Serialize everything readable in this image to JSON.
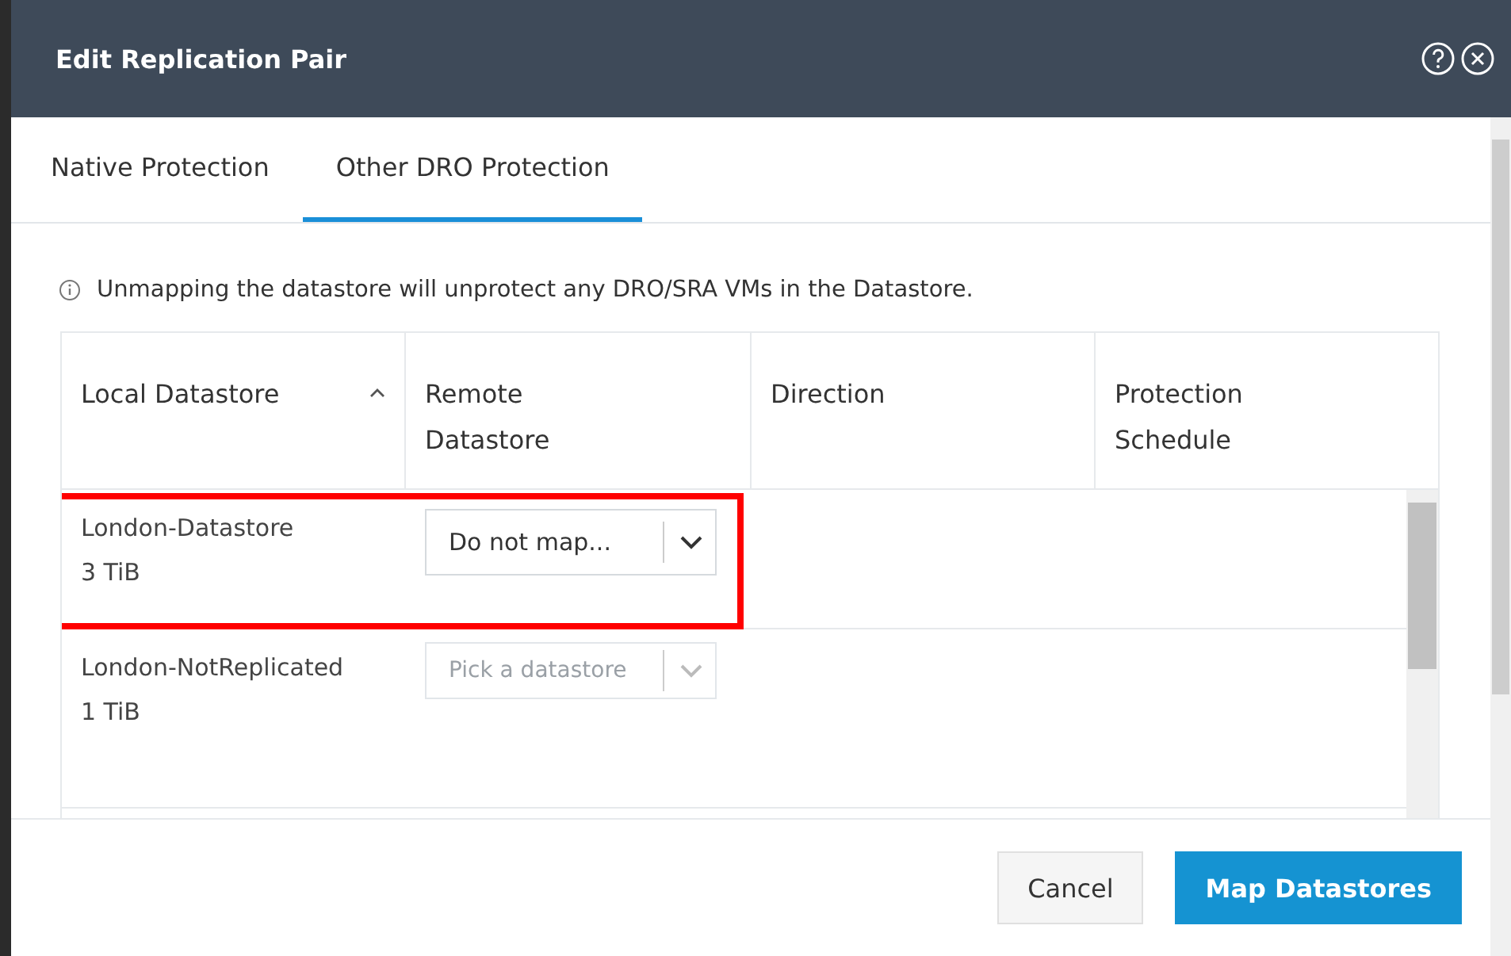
{
  "window": {
    "title": "Edit Replication Pair"
  },
  "tabs": [
    {
      "label": "Native Protection",
      "selected": false
    },
    {
      "label": "Other DRO Protection",
      "selected": true
    }
  ],
  "notice": "Unmapping the datastore will unprotect any DRO/SRA VMs in the Datastore.",
  "table": {
    "columns": [
      {
        "label": "Local Datastore",
        "sorted": true
      },
      {
        "label": "Remote Datastore",
        "sorted": false
      },
      {
        "label": "Direction",
        "sorted": false
      },
      {
        "label": "Protection Schedule",
        "sorted": false
      }
    ],
    "rows": [
      {
        "name": "London-Datastore",
        "size": "3 TiB",
        "remote": "Do not map...",
        "disabled": false,
        "highlighted": true
      },
      {
        "name": "London-NotReplicated",
        "size": "1 TiB",
        "remote": "Pick a datastore",
        "disabled": true,
        "highlighted": false
      }
    ]
  },
  "buttons": [
    {
      "label": "Cancel",
      "kind": "secondary"
    },
    {
      "label": "Map Datastores",
      "kind": "primary"
    }
  ]
}
